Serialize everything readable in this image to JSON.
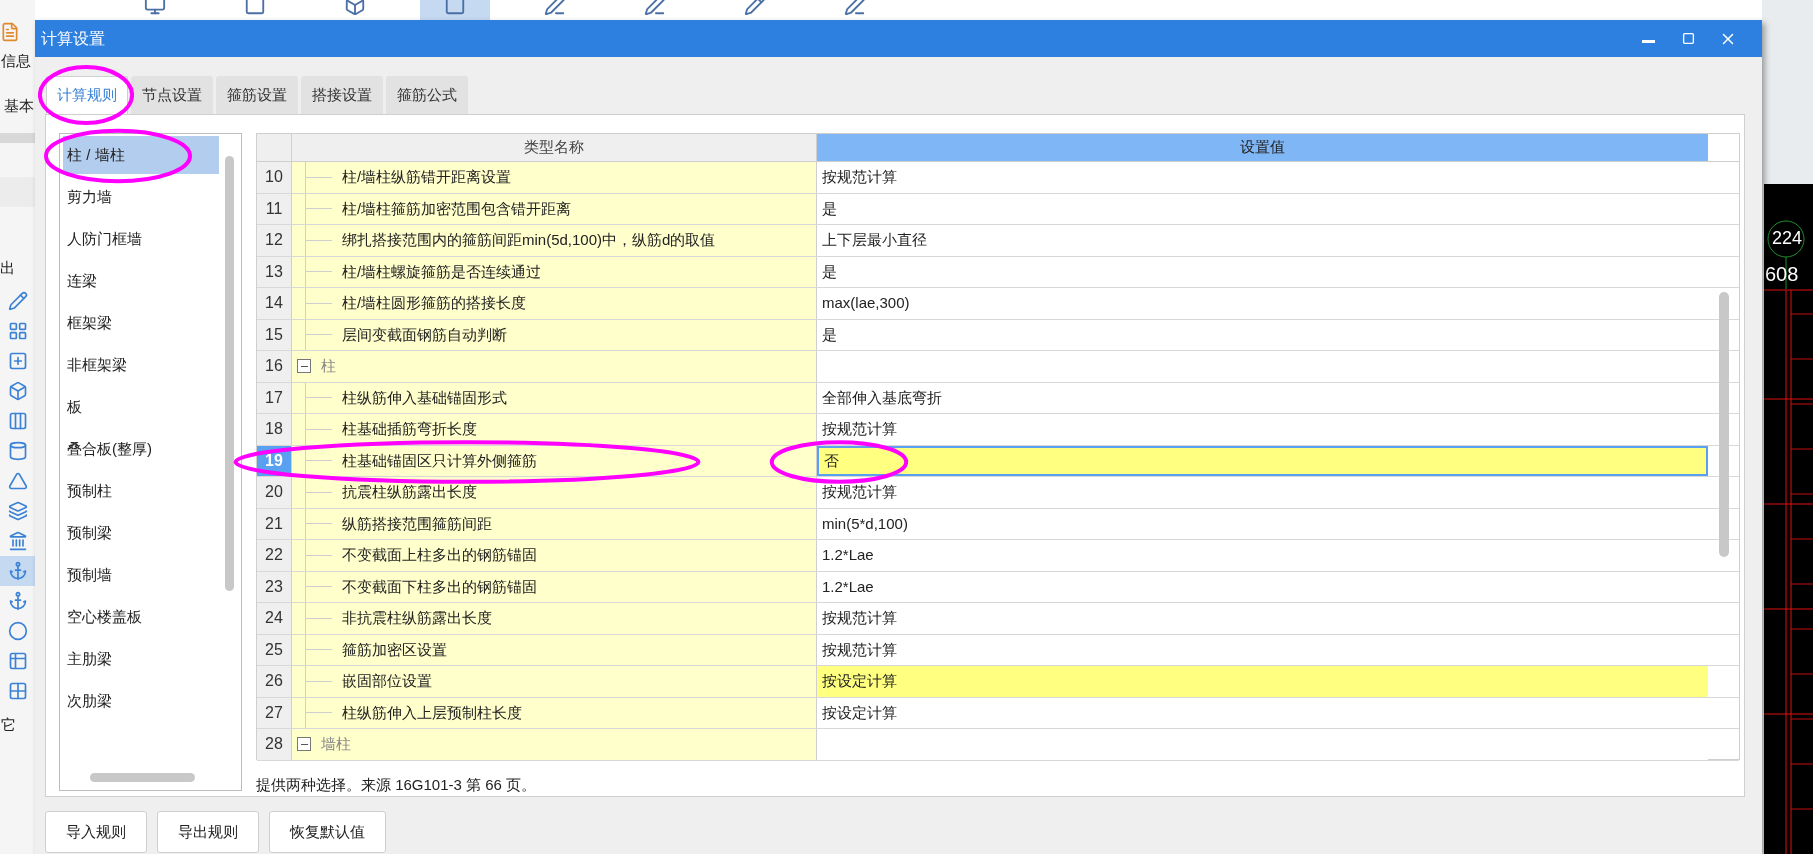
{
  "background_app": {
    "side_labels": [
      "信息",
      "基本",
      "出",
      "它"
    ],
    "top_toolbar": {
      "tools": [
        {
          "selected": false
        },
        {
          "selected": false
        },
        {
          "selected": false
        },
        {
          "selected": true
        },
        {
          "selected": false
        },
        {
          "selected": false
        },
        {
          "selected": false
        },
        {
          "selected": false
        }
      ]
    },
    "left_toolbar": {
      "tools": [
        {
          "selected": false
        },
        {
          "selected": false
        },
        {
          "selected": false
        },
        {
          "selected": false
        },
        {
          "selected": false
        },
        {
          "selected": false
        },
        {
          "selected": false
        },
        {
          "selected": false
        },
        {
          "selected": false
        },
        {
          "selected": true
        },
        {
          "selected": false
        },
        {
          "selected": false
        },
        {
          "selected": false
        },
        {
          "selected": false
        }
      ]
    },
    "cad_labels": [
      "224",
      "608"
    ]
  },
  "window": {
    "title": "计算设置"
  },
  "tabs": [
    {
      "label": "计算规则",
      "selected": true,
      "circled": true
    },
    {
      "label": "节点设置",
      "selected": false,
      "circled": false
    },
    {
      "label": "箍筋设置",
      "selected": false,
      "circled": false
    },
    {
      "label": "搭接设置",
      "selected": false,
      "circled": false
    },
    {
      "label": "箍筋公式",
      "selected": false,
      "circled": false
    }
  ],
  "sidebar": {
    "items": [
      {
        "label": "柱 / 墙柱",
        "selected": true,
        "circled": true
      },
      {
        "label": "剪力墙",
        "selected": false,
        "circled": false
      },
      {
        "label": "人防门框墙",
        "selected": false,
        "circled": false
      },
      {
        "label": "连梁",
        "selected": false,
        "circled": false
      },
      {
        "label": "框架梁",
        "selected": false,
        "circled": false
      },
      {
        "label": "非框架梁",
        "selected": false,
        "circled": false
      },
      {
        "label": "板",
        "selected": false,
        "circled": false
      },
      {
        "label": "叠合板(整厚)",
        "selected": false,
        "circled": false
      },
      {
        "label": "预制柱",
        "selected": false,
        "circled": false
      },
      {
        "label": "预制梁",
        "selected": false,
        "circled": false
      },
      {
        "label": "预制墙",
        "selected": false,
        "circled": false
      },
      {
        "label": "空心楼盖板",
        "selected": false,
        "circled": false
      },
      {
        "label": "主肋梁",
        "selected": false,
        "circled": false
      },
      {
        "label": "次肋梁",
        "selected": false,
        "circled": false
      }
    ]
  },
  "table": {
    "columns": [
      "类型名称",
      "设置值"
    ],
    "rows": [
      {
        "kind": "item",
        "number": "10",
        "name": "柱/墙柱纵筋错开距离设置",
        "value": "按规范计算",
        "selected": false,
        "highlighted": false,
        "name_circled": false,
        "value_circled": false
      },
      {
        "kind": "item",
        "number": "11",
        "name": "柱/墙柱箍筋加密范围包含错开距离",
        "value": "是",
        "selected": false,
        "highlighted": false,
        "name_circled": false,
        "value_circled": false
      },
      {
        "kind": "item",
        "number": "12",
        "name": "绑扎搭接范围内的箍筋间距min(5d,100)中，纵筋d的取值",
        "value": "上下层最小直径",
        "selected": false,
        "highlighted": false,
        "name_circled": false,
        "value_circled": false
      },
      {
        "kind": "item",
        "number": "13",
        "name": "柱/墙柱螺旋箍筋是否连续通过",
        "value": "是",
        "selected": false,
        "highlighted": false,
        "name_circled": false,
        "value_circled": false
      },
      {
        "kind": "item",
        "number": "14",
        "name": "柱/墙柱圆形箍筋的搭接长度",
        "value": "max(lae,300)",
        "selected": false,
        "highlighted": false,
        "name_circled": false,
        "value_circled": false
      },
      {
        "kind": "item",
        "number": "15",
        "name": "层间变截面钢筋自动判断",
        "value": "是",
        "selected": false,
        "highlighted": false,
        "name_circled": false,
        "value_circled": false
      },
      {
        "kind": "group",
        "number": "16",
        "name": "柱",
        "expanded": true
      },
      {
        "kind": "item",
        "number": "17",
        "name": "柱纵筋伸入基础锚固形式",
        "value": "全部伸入基底弯折",
        "selected": false,
        "highlighted": false,
        "name_circled": false,
        "value_circled": false
      },
      {
        "kind": "item",
        "number": "18",
        "name": "柱基础插筋弯折长度",
        "value": "按规范计算",
        "selected": false,
        "highlighted": false,
        "name_circled": false,
        "value_circled": false
      },
      {
        "kind": "item",
        "number": "19",
        "name": "柱基础锚固区只计算外侧箍筋",
        "value": "否",
        "selected": true,
        "highlighted": true,
        "name_circled": true,
        "value_circled": true
      },
      {
        "kind": "item",
        "number": "20",
        "name": "抗震柱纵筋露出长度",
        "value": "按规范计算",
        "selected": false,
        "highlighted": false,
        "name_circled": false,
        "value_circled": false
      },
      {
        "kind": "item",
        "number": "21",
        "name": "纵筋搭接范围箍筋间距",
        "value": "min(5*d,100)",
        "selected": false,
        "highlighted": false,
        "name_circled": false,
        "value_circled": false
      },
      {
        "kind": "item",
        "number": "22",
        "name": "不变截面上柱多出的钢筋锚固",
        "value": "1.2*Lae",
        "selected": false,
        "highlighted": false,
        "name_circled": false,
        "value_circled": false
      },
      {
        "kind": "item",
        "number": "23",
        "name": "不变截面下柱多出的钢筋锚固",
        "value": "1.2*Lae",
        "selected": false,
        "highlighted": false,
        "name_circled": false,
        "value_circled": false
      },
      {
        "kind": "item",
        "number": "24",
        "name": "非抗震柱纵筋露出长度",
        "value": "按规范计算",
        "selected": false,
        "highlighted": false,
        "name_circled": false,
        "value_circled": false
      },
      {
        "kind": "item",
        "number": "25",
        "name": "箍筋加密区设置",
        "value": "按规范计算",
        "selected": false,
        "highlighted": false,
        "name_circled": false,
        "value_circled": false
      },
      {
        "kind": "item",
        "number": "26",
        "name": "嵌固部位设置",
        "value": "按设定计算",
        "selected": false,
        "highlighted": true,
        "name_circled": false,
        "value_circled": false
      },
      {
        "kind": "item",
        "number": "27",
        "name": "柱纵筋伸入上层预制柱长度",
        "value": "按设定计算",
        "selected": false,
        "highlighted": false,
        "name_circled": false,
        "value_circled": false
      },
      {
        "kind": "group",
        "number": "28",
        "name": "墙柱",
        "expanded": true
      }
    ]
  },
  "description": "提供两种选择。来源 16G101-3 第 66 页。",
  "buttons": [
    "导入规则",
    "导出规则",
    "恢复默认值"
  ]
}
